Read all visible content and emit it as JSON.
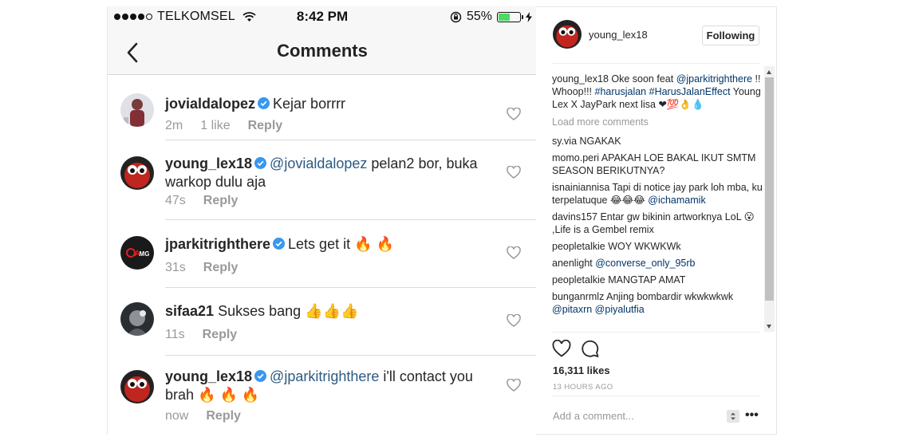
{
  "statusbar": {
    "carrier": "TELKOMSEL",
    "time": "8:42 PM",
    "battery_pct": "55%",
    "battery_level": 0.55,
    "icons": [
      "signal-dots-icon",
      "wifi-icon",
      "lock-rotation-icon",
      "battery-icon",
      "charging-icon"
    ]
  },
  "nav": {
    "title": "Comments"
  },
  "comments": [
    {
      "username": "jovialdalopez",
      "verified": true,
      "mention": "",
      "text": "Kejar borrrr",
      "time": "2m",
      "likes": "1 like",
      "reply": "Reply"
    },
    {
      "username": "young_lex18",
      "verified": true,
      "mention": "@jovialdalopez",
      "text": " pelan2 bor, buka warkop dulu aja",
      "time": "47s",
      "likes": "",
      "reply": "Reply"
    },
    {
      "username": "jparkitrighthere",
      "verified": true,
      "mention": "",
      "text": "Lets get it 🔥 🔥",
      "time": "31s",
      "likes": "",
      "reply": "Reply"
    },
    {
      "username": "sifaa21",
      "verified": false,
      "mention": "",
      "text": "Sukses bang 👍👍👍",
      "time": "11s",
      "likes": "",
      "reply": "Reply"
    },
    {
      "username": "young_lex18",
      "verified": true,
      "mention": "@jparkitrighthere",
      "text": " i'll contact you brah 🔥 🔥 🔥",
      "time": "now",
      "likes": "",
      "reply": "Reply"
    }
  ],
  "panel": {
    "username": "young_lex18",
    "follow_label": "Following",
    "caption": {
      "user": "young_lex18",
      "text_a": " Oke soon feat ",
      "link_a": "@jparkitrighthere",
      "text_b": " !! Whoop!!! ",
      "link_b": "#harusjalan",
      "link_c": "#HarusJalanEffect",
      "text_c": " Young Lex X JayPark next lisa ❤💯👌💧"
    },
    "load_more": "Load more comments",
    "comments": [
      {
        "user": "sy.via",
        "text": " NGAKAK",
        "link": ""
      },
      {
        "user": "momo.peri",
        "text": " APAKAH LOE BAKAL IKUT SMTM SEASON BERIKUTNYA?",
        "link": ""
      },
      {
        "user": "isnainiannisa",
        "text": " Tapi di notice jay park loh mba, ku terpelatuque 😂😂😂 ",
        "link": "@ichamamik"
      },
      {
        "user": "davins157",
        "text": " Entar gw bikinin artworknya LoL 😮 ,Life is a Gembel remix",
        "link": ""
      },
      {
        "user": "peopletalkie",
        "text": " WOY WKWKWk",
        "link": ""
      },
      {
        "user": "anenlight",
        "text": " ",
        "link": "@converse_only_95rb"
      },
      {
        "user": "peopletalkie",
        "text": " MANGTAP AMAT",
        "link": ""
      },
      {
        "user": "bunganrmlz",
        "text": " Anjing bombardir wkwkwkwk ",
        "link": "@pitaxrn @piyalutfia"
      }
    ],
    "likes": "16,311 likes",
    "time_ago": "13 HOURS AGO",
    "add_comment_placeholder": "Add a comment...",
    "more_label": "•••"
  }
}
